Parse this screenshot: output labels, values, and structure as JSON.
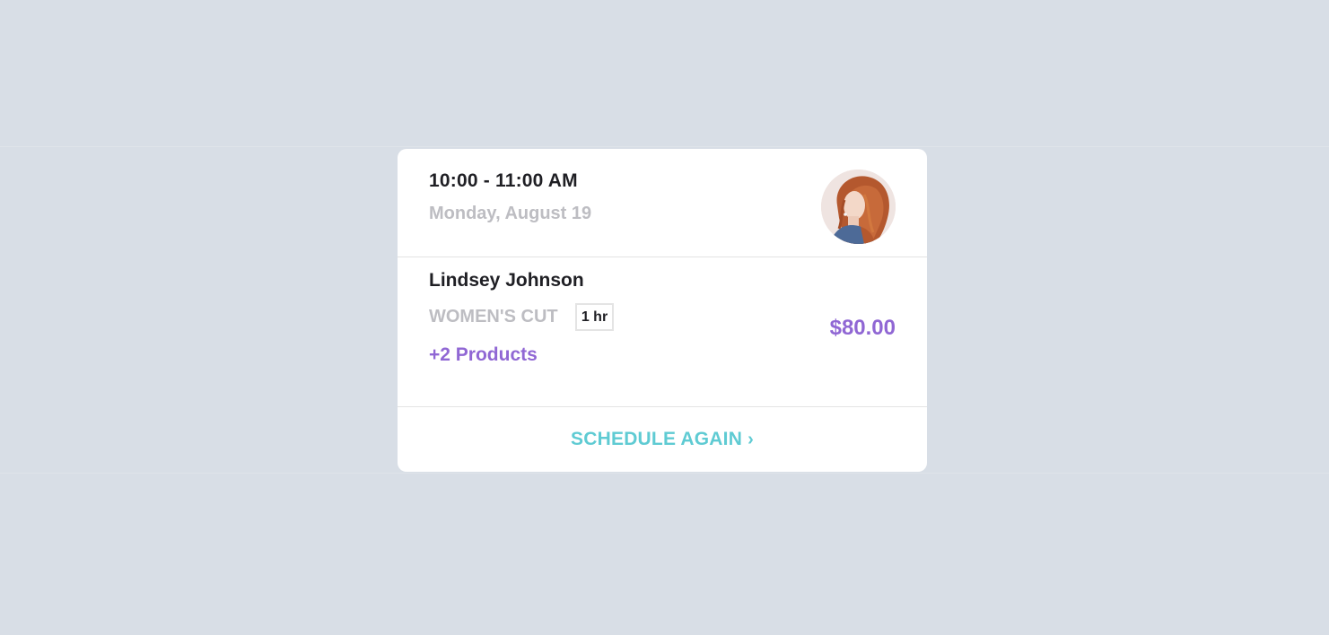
{
  "appointment": {
    "time_range": "10:00 - 11:00 AM",
    "date": "Monday, August 19"
  },
  "client": {
    "name": "Lindsey Johnson"
  },
  "service": {
    "name": "WOMEN'S CUT",
    "duration": "1 hr",
    "extra_products": "+2 Products",
    "price": "$80.00"
  },
  "actions": {
    "schedule_again": "SCHEDULE AGAIN",
    "chevron_icon": "chevron-right-icon"
  },
  "colors": {
    "background": "#d8dee6",
    "card": "#ffffff",
    "accent_purple": "#9067d4",
    "accent_teal": "#5fcbd3",
    "muted_text": "#bdbdc2",
    "primary_text": "#1f1f24"
  }
}
